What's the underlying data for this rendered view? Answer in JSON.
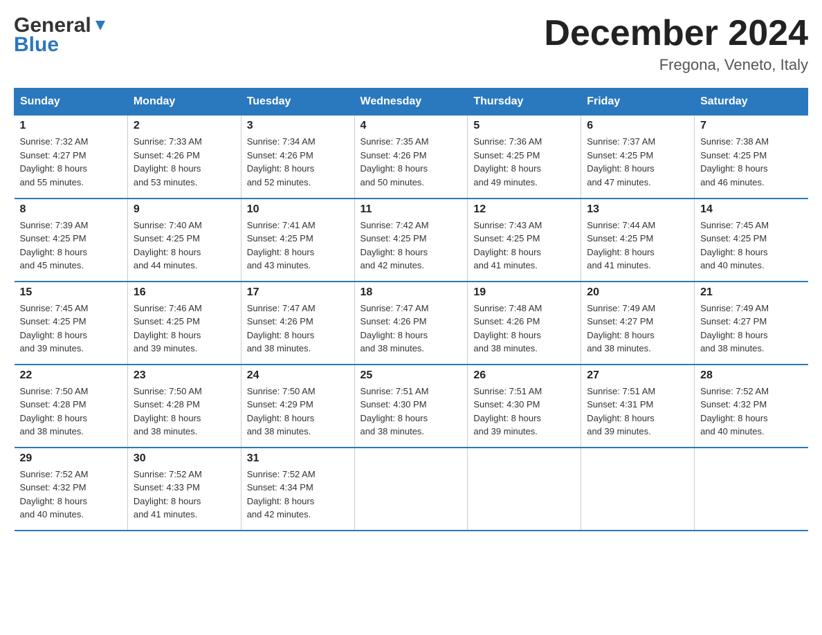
{
  "header": {
    "logo_line1": "General",
    "logo_line2": "Blue",
    "month": "December 2024",
    "location": "Fregona, Veneto, Italy"
  },
  "days_of_week": [
    "Sunday",
    "Monday",
    "Tuesday",
    "Wednesday",
    "Thursday",
    "Friday",
    "Saturday"
  ],
  "weeks": [
    [
      {
        "day": "1",
        "sunrise": "7:32 AM",
        "sunset": "4:27 PM",
        "daylight": "8 hours and 55 minutes."
      },
      {
        "day": "2",
        "sunrise": "7:33 AM",
        "sunset": "4:26 PM",
        "daylight": "8 hours and 53 minutes."
      },
      {
        "day": "3",
        "sunrise": "7:34 AM",
        "sunset": "4:26 PM",
        "daylight": "8 hours and 52 minutes."
      },
      {
        "day": "4",
        "sunrise": "7:35 AM",
        "sunset": "4:26 PM",
        "daylight": "8 hours and 50 minutes."
      },
      {
        "day": "5",
        "sunrise": "7:36 AM",
        "sunset": "4:25 PM",
        "daylight": "8 hours and 49 minutes."
      },
      {
        "day": "6",
        "sunrise": "7:37 AM",
        "sunset": "4:25 PM",
        "daylight": "8 hours and 47 minutes."
      },
      {
        "day": "7",
        "sunrise": "7:38 AM",
        "sunset": "4:25 PM",
        "daylight": "8 hours and 46 minutes."
      }
    ],
    [
      {
        "day": "8",
        "sunrise": "7:39 AM",
        "sunset": "4:25 PM",
        "daylight": "8 hours and 45 minutes."
      },
      {
        "day": "9",
        "sunrise": "7:40 AM",
        "sunset": "4:25 PM",
        "daylight": "8 hours and 44 minutes."
      },
      {
        "day": "10",
        "sunrise": "7:41 AM",
        "sunset": "4:25 PM",
        "daylight": "8 hours and 43 minutes."
      },
      {
        "day": "11",
        "sunrise": "7:42 AM",
        "sunset": "4:25 PM",
        "daylight": "8 hours and 42 minutes."
      },
      {
        "day": "12",
        "sunrise": "7:43 AM",
        "sunset": "4:25 PM",
        "daylight": "8 hours and 41 minutes."
      },
      {
        "day": "13",
        "sunrise": "7:44 AM",
        "sunset": "4:25 PM",
        "daylight": "8 hours and 41 minutes."
      },
      {
        "day": "14",
        "sunrise": "7:45 AM",
        "sunset": "4:25 PM",
        "daylight": "8 hours and 40 minutes."
      }
    ],
    [
      {
        "day": "15",
        "sunrise": "7:45 AM",
        "sunset": "4:25 PM",
        "daylight": "8 hours and 39 minutes."
      },
      {
        "day": "16",
        "sunrise": "7:46 AM",
        "sunset": "4:25 PM",
        "daylight": "8 hours and 39 minutes."
      },
      {
        "day": "17",
        "sunrise": "7:47 AM",
        "sunset": "4:26 PM",
        "daylight": "8 hours and 38 minutes."
      },
      {
        "day": "18",
        "sunrise": "7:47 AM",
        "sunset": "4:26 PM",
        "daylight": "8 hours and 38 minutes."
      },
      {
        "day": "19",
        "sunrise": "7:48 AM",
        "sunset": "4:26 PM",
        "daylight": "8 hours and 38 minutes."
      },
      {
        "day": "20",
        "sunrise": "7:49 AM",
        "sunset": "4:27 PM",
        "daylight": "8 hours and 38 minutes."
      },
      {
        "day": "21",
        "sunrise": "7:49 AM",
        "sunset": "4:27 PM",
        "daylight": "8 hours and 38 minutes."
      }
    ],
    [
      {
        "day": "22",
        "sunrise": "7:50 AM",
        "sunset": "4:28 PM",
        "daylight": "8 hours and 38 minutes."
      },
      {
        "day": "23",
        "sunrise": "7:50 AM",
        "sunset": "4:28 PM",
        "daylight": "8 hours and 38 minutes."
      },
      {
        "day": "24",
        "sunrise": "7:50 AM",
        "sunset": "4:29 PM",
        "daylight": "8 hours and 38 minutes."
      },
      {
        "day": "25",
        "sunrise": "7:51 AM",
        "sunset": "4:30 PM",
        "daylight": "8 hours and 38 minutes."
      },
      {
        "day": "26",
        "sunrise": "7:51 AM",
        "sunset": "4:30 PM",
        "daylight": "8 hours and 39 minutes."
      },
      {
        "day": "27",
        "sunrise": "7:51 AM",
        "sunset": "4:31 PM",
        "daylight": "8 hours and 39 minutes."
      },
      {
        "day": "28",
        "sunrise": "7:52 AM",
        "sunset": "4:32 PM",
        "daylight": "8 hours and 40 minutes."
      }
    ],
    [
      {
        "day": "29",
        "sunrise": "7:52 AM",
        "sunset": "4:32 PM",
        "daylight": "8 hours and 40 minutes."
      },
      {
        "day": "30",
        "sunrise": "7:52 AM",
        "sunset": "4:33 PM",
        "daylight": "8 hours and 41 minutes."
      },
      {
        "day": "31",
        "sunrise": "7:52 AM",
        "sunset": "4:34 PM",
        "daylight": "8 hours and 42 minutes."
      },
      null,
      null,
      null,
      null
    ]
  ],
  "labels": {
    "sunrise": "Sunrise:",
    "sunset": "Sunset:",
    "daylight": "Daylight:"
  }
}
